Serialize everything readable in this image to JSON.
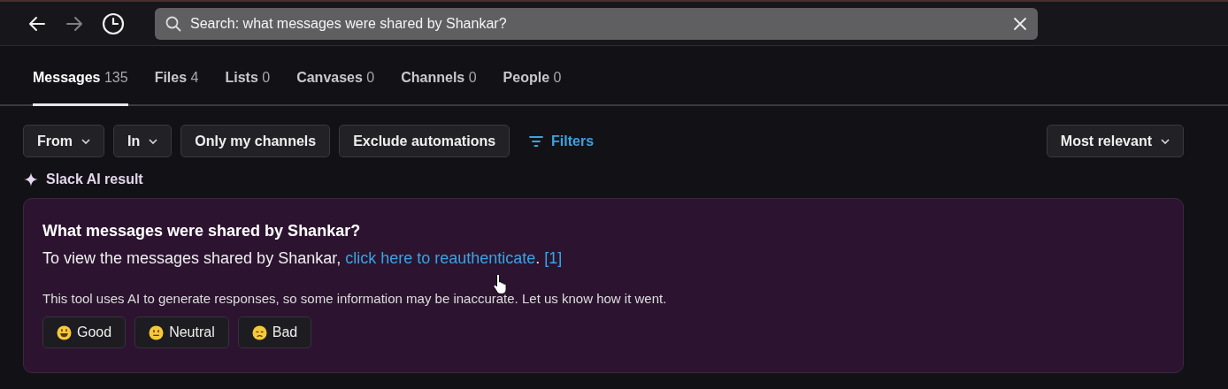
{
  "nav": {
    "back": {
      "disabled": false
    },
    "forward": {
      "disabled": true
    }
  },
  "search": {
    "value": "Search: what messages were shared by Shankar?"
  },
  "tabs": [
    {
      "label": "Messages",
      "count": "135",
      "selected": true
    },
    {
      "label": "Files",
      "count": "4",
      "selected": false
    },
    {
      "label": "Lists",
      "count": "0",
      "selected": false
    },
    {
      "label": "Canvases",
      "count": "0",
      "selected": false
    },
    {
      "label": "Channels",
      "count": "0",
      "selected": false
    },
    {
      "label": "People",
      "count": "0",
      "selected": false
    }
  ],
  "filters": [
    {
      "label": "From",
      "kind": "dropdown"
    },
    {
      "label": "In",
      "kind": "dropdown"
    },
    {
      "label": "Only my channels",
      "kind": "toggle"
    },
    {
      "label": "Exclude automations",
      "kind": "toggle"
    },
    {
      "label": "Filters",
      "kind": "link"
    }
  ],
  "sort": {
    "label": "Most relevant"
  },
  "ai_result": {
    "heading": "Slack AI result",
    "question": "What messages were shared by Shankar?",
    "answer_before": "To view the messages shared by Shankar,",
    "answer_link": "click here to reauthenticate",
    "answer_after": ".",
    "citation": "[1]",
    "disclaimer": "This tool uses AI to generate responses, so some information may be inaccurate. Let us know how it went.",
    "feedback": [
      {
        "label": "Good",
        "kind": "good"
      },
      {
        "label": "Neutral",
        "kind": "neutral"
      },
      {
        "label": "Bad",
        "kind": "bad"
      }
    ]
  }
}
